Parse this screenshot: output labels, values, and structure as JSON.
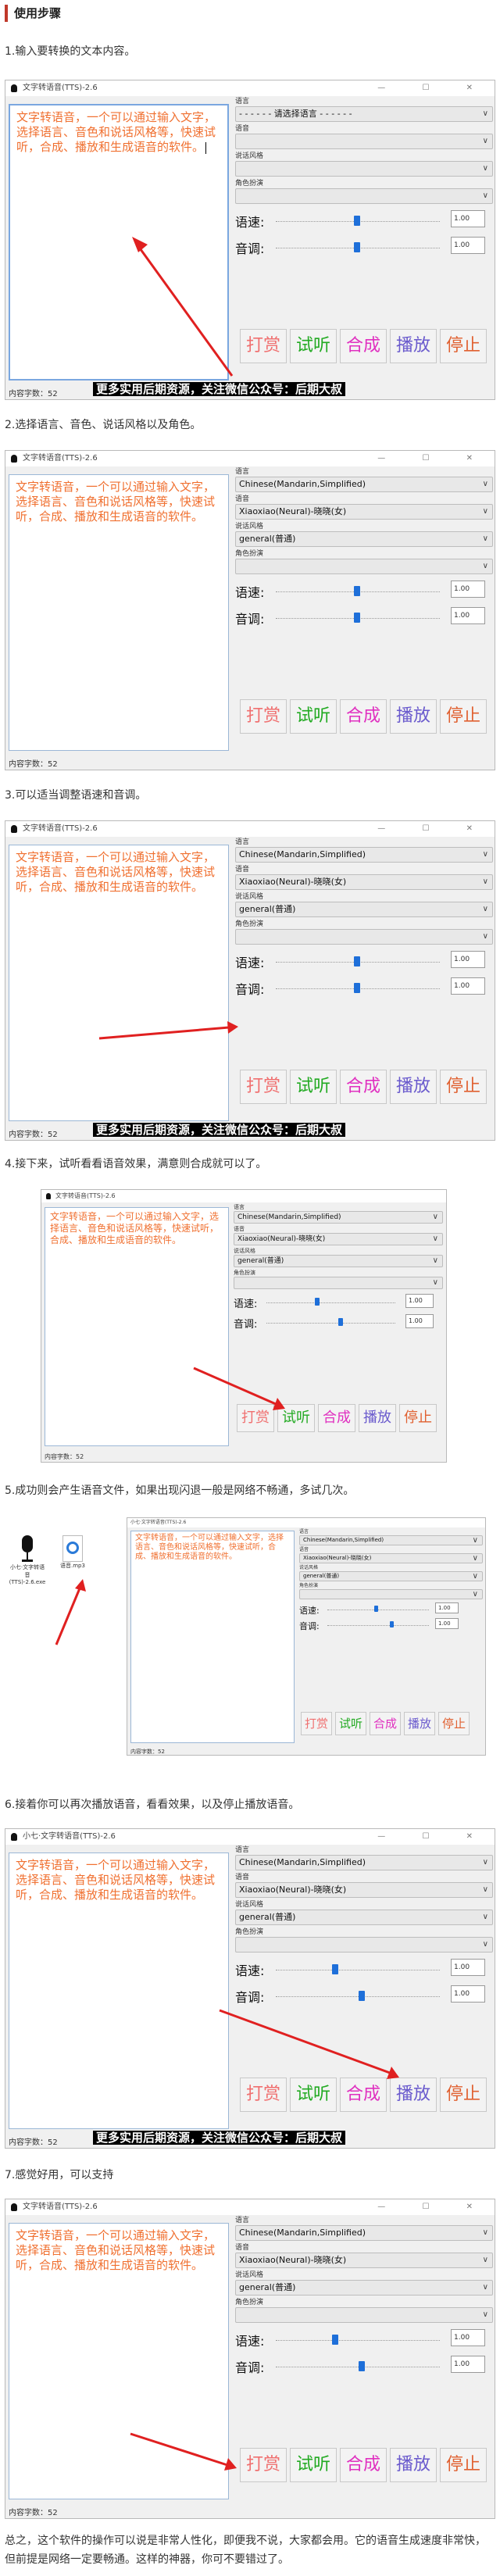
{
  "heading": "使用步骤",
  "app": {
    "title_full": "文字转语音(TTS)-2.6",
    "title_small": "小七·文字转语音(TTS)-2.6",
    "text_content": "文字转语音，一个可以通过输入文字，选择语言、音色和说话风格等，快速试听，合成、播放和生成语音的软件。",
    "count_label": "内容字数：52",
    "labels": {
      "language": "语言",
      "voice": "语音",
      "style": "说话风格",
      "role": "角色扮演",
      "speed": "语速:",
      "pitch": "音调:"
    },
    "values": {
      "language_placeholder": "- - - - - - 请选择语言 - - - - - -",
      "language": "Chinese(Mandarin,Simplified)",
      "voice": "Xiaoxiao(Neural)-晓晓(女)",
      "style": "general(普通)",
      "speed": "1.00",
      "pitch": "1.00"
    },
    "buttons": {
      "dashang": "打赏",
      "shiting": "试听",
      "hecheng": "合成",
      "bofang": "播放",
      "tingzhi": "停止"
    },
    "window_controls": "—  ☐  ✕"
  },
  "banner": "更多实用后期资源，关注微信公众号：后期大叔",
  "steps": [
    "1.输入要转换的文本内容。",
    "2.选择语言、音色、说话风格以及角色。",
    "3.可以适当调整语速和音调。",
    "4.接下来，试听看看语音效果，满意则合成就可以了。",
    "5.成功则会产生语音文件，如果出现闪退一般是网络不畅通，多试几次。",
    "6.接着你可以再次播放语音，看看效果，以及停止播放语音。",
    "7.感觉好用，可以支持"
  ],
  "desktop": {
    "exe_label": "小七·文字转语音(TTS)-2.6.exe",
    "mp3_label": "语音.mp3"
  },
  "summary": "总之，这个软件的操作可以说是非常人性化，即便我不说，大家都会用。它的语音生成速度非常快，但前提是网络一定要畅通。这样的神器，你可不要错过了。"
}
